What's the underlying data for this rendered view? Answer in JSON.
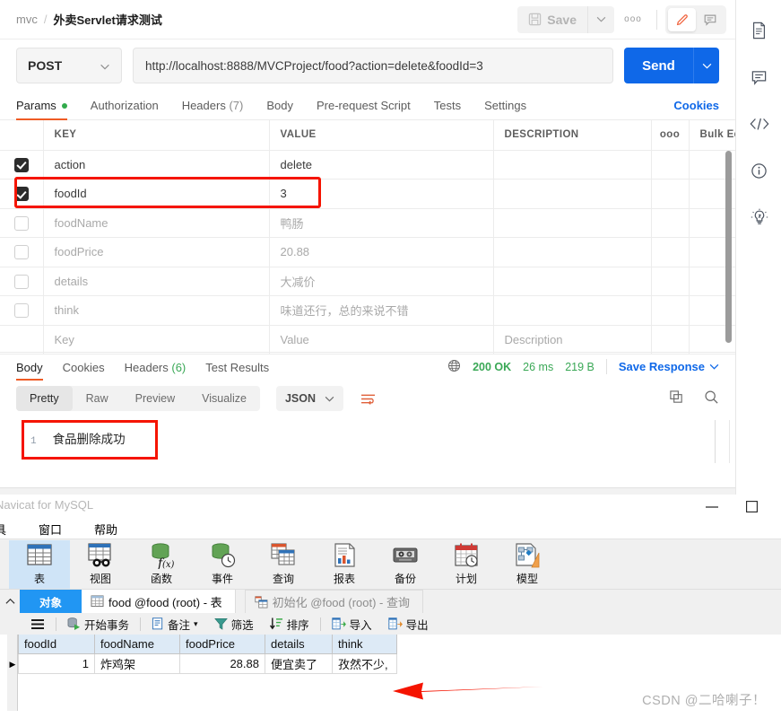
{
  "postman": {
    "breadcrumb": {
      "collection": "mvc",
      "separator": "/",
      "request": "外卖Servlet请求测试"
    },
    "topbar": {
      "save_label": "Save",
      "save_caret": "⌄",
      "more_label": "ooo",
      "pencil_icon": "pencil-icon",
      "comment_icon": "comment-icon"
    },
    "url_row": {
      "method": "POST",
      "method_caret": "⌄",
      "url": "http://localhost:8888/MVCProject/food?action=delete&foodId=3",
      "send_label": "Send",
      "send_caret": "⌄"
    },
    "request_tabs": [
      {
        "label": "Params",
        "badge": "dot",
        "active": true
      },
      {
        "label": "Authorization",
        "active": false
      },
      {
        "label": "Headers",
        "count": "(7)",
        "active": false
      },
      {
        "label": "Body",
        "active": false
      },
      {
        "label": "Pre-request Script",
        "active": false
      },
      {
        "label": "Tests",
        "active": false
      },
      {
        "label": "Settings",
        "active": false
      }
    ],
    "cookies_link": "Cookies",
    "params_table": {
      "headers": {
        "key": "KEY",
        "value": "VALUE",
        "description": "DESCRIPTION",
        "more": "ooo",
        "bulk_edit": "Bulk Edit"
      },
      "rows": [
        {
          "checked": true,
          "key": "action",
          "value": "delete",
          "description": "",
          "muted": false,
          "highlight": false
        },
        {
          "checked": true,
          "key": "foodId",
          "value": "3",
          "description": "",
          "muted": false,
          "highlight": true
        },
        {
          "checked": false,
          "key": "foodName",
          "value": "鸭肠",
          "description": "",
          "muted": true,
          "highlight": false
        },
        {
          "checked": false,
          "key": "foodPrice",
          "value": "20.88",
          "description": "",
          "muted": true,
          "highlight": false
        },
        {
          "checked": false,
          "key": "details",
          "value": "大减价",
          "description": "",
          "muted": true,
          "highlight": false
        },
        {
          "checked": false,
          "key": "think",
          "value": "味道还行，总的来说不错",
          "description": "",
          "muted": true,
          "highlight": false
        },
        {
          "checked": null,
          "key": "Key",
          "value": "Value",
          "description": "Description",
          "muted": true,
          "highlight": false
        }
      ]
    },
    "response": {
      "tabs": [
        {
          "label": "Body",
          "active": true
        },
        {
          "label": "Cookies",
          "active": false
        },
        {
          "label": "Headers",
          "count": "(6)",
          "active": false
        },
        {
          "label": "Test Results",
          "active": false
        }
      ],
      "globe_icon": "globe-icon",
      "status": "200 OK",
      "time": "26 ms",
      "size": "219 B",
      "save_response": "Save Response",
      "save_response_caret": "⌄",
      "view_modes": [
        {
          "label": "Pretty",
          "active": true
        },
        {
          "label": "Raw",
          "active": false
        },
        {
          "label": "Preview",
          "active": false
        },
        {
          "label": "Visualize",
          "active": false
        }
      ],
      "format": "JSON",
      "format_caret": "⌄",
      "wrap_icon": "wrap-lines-icon",
      "copy_icon": "copy-icon",
      "search_icon": "search-icon",
      "body_line_number": "1",
      "body_text": "食品删除成功"
    },
    "right_rail": [
      {
        "icon": "document-icon"
      },
      {
        "icon": "comment-icon"
      },
      {
        "icon": "code-icon"
      },
      {
        "icon": "info-icon"
      },
      {
        "icon": "bulb-icon"
      }
    ],
    "colors": {
      "accent": "#ef5b25",
      "send_blue": "#0f68e8",
      "success_green": "#3aa856",
      "highlight_red": "#f51400"
    }
  },
  "navicat": {
    "title": "Navicat for MySQL",
    "window_buttons": {
      "minimize": "—",
      "maximize": "□"
    },
    "menu": [
      "具",
      "窗口",
      "帮助"
    ],
    "toolbar": [
      {
        "label": "表",
        "icon": "table-icon",
        "selected": true
      },
      {
        "label": "视图",
        "icon": "view-icon",
        "selected": false
      },
      {
        "label": "函数",
        "icon": "function-icon",
        "selected": false
      },
      {
        "label": "事件",
        "icon": "event-icon",
        "selected": false
      },
      {
        "label": "查询",
        "icon": "query-icon",
        "selected": false
      },
      {
        "label": "报表",
        "icon": "report-icon",
        "selected": false
      },
      {
        "label": "备份",
        "icon": "backup-icon",
        "selected": false
      },
      {
        "label": "计划",
        "icon": "schedule-icon",
        "selected": false
      },
      {
        "label": "模型",
        "icon": "model-icon",
        "selected": false
      }
    ],
    "tabs": {
      "collapse_icon": "chevron-up-icon",
      "objects_tab": "对象",
      "table_tab": "food @food (root) - 表",
      "query_tab": "初始化 @food (root) - 查询"
    },
    "data_toolbar": [
      {
        "label": "",
        "icon": "menu-icon"
      },
      {
        "label": "开始事务",
        "icon": "begin-transaction-icon"
      },
      {
        "label": "备注",
        "icon": "note-icon",
        "caret": "▾"
      },
      {
        "label": "筛选",
        "icon": "filter-icon"
      },
      {
        "label": "排序",
        "icon": "sort-icon"
      },
      {
        "label": "导入",
        "icon": "import-icon"
      },
      {
        "label": "导出",
        "icon": "export-icon"
      }
    ],
    "grid": {
      "columns": [
        "foodId",
        "foodName",
        "foodPrice",
        "details",
        "think"
      ],
      "rows": [
        {
          "marker": "▶",
          "foodId": "1",
          "foodName": "炸鸡架",
          "foodPrice": "28.88",
          "details": "便宜卖了",
          "think": "孜然不少,"
        }
      ]
    }
  },
  "annotations": {
    "red_arrow": "red-left-arrow",
    "watermark": "CSDN @二哈喇子！"
  }
}
